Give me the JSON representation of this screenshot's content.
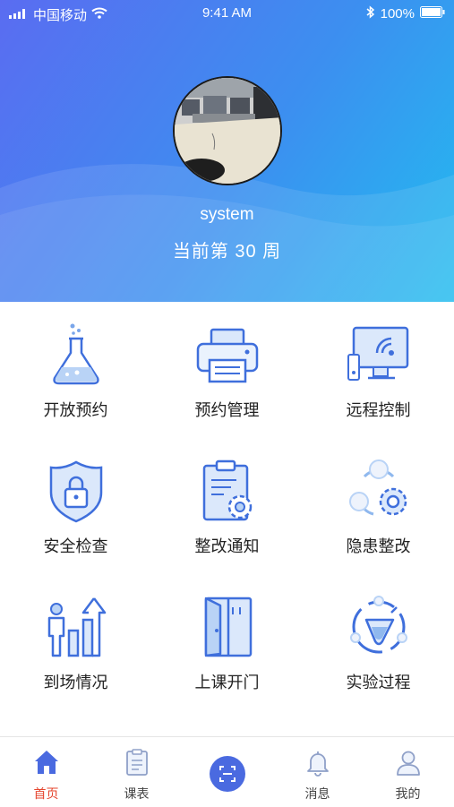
{
  "status_bar": {
    "carrier": "中国移动",
    "time": "9:41 AM",
    "battery": "100%"
  },
  "profile": {
    "username": "system",
    "week_text": "当前第 30 周"
  },
  "grid": {
    "items": [
      {
        "label": "开放预约",
        "icon": "flask-icon"
      },
      {
        "label": "预约管理",
        "icon": "printer-icon"
      },
      {
        "label": "远程控制",
        "icon": "monitor-wireless-icon"
      },
      {
        "label": "安全检查",
        "icon": "shield-lock-icon"
      },
      {
        "label": "整改通知",
        "icon": "clipboard-gear-icon"
      },
      {
        "label": "隐患整改",
        "icon": "cycle-gear-icon"
      },
      {
        "label": "到场情况",
        "icon": "attendance-chart-icon"
      },
      {
        "label": "上课开门",
        "icon": "door-icon"
      },
      {
        "label": "实验过程",
        "icon": "experiment-process-icon"
      }
    ]
  },
  "tabbar": {
    "tabs": [
      {
        "label": "首页",
        "icon": "home-icon",
        "active": true
      },
      {
        "label": "课表",
        "icon": "schedule-icon",
        "active": false
      },
      {
        "label": "",
        "icon": "scan-icon",
        "active": false
      },
      {
        "label": "消息",
        "icon": "bell-icon",
        "active": false
      },
      {
        "label": "我的",
        "icon": "user-icon",
        "active": false
      }
    ]
  },
  "colors": {
    "accent": "#4a6ae0",
    "active_tab": "#e5452e",
    "icon_stroke": "#3f6fdc",
    "icon_fill": "#dbe8fb"
  }
}
